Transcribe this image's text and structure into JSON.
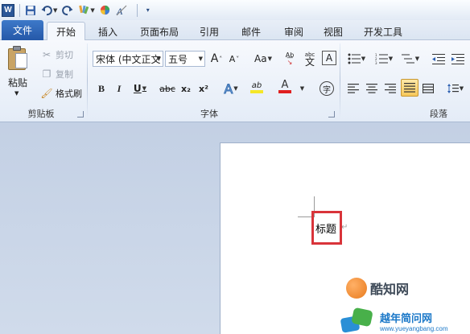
{
  "qat": {
    "app_icon_letter": "W",
    "buttons": [
      "save-icon",
      "undo-icon",
      "redo-icon",
      "highlighter-icon",
      "color-wheel-icon",
      "clear-format-icon"
    ]
  },
  "tabs": {
    "file": "文件",
    "items": [
      "开始",
      "插入",
      "页面布局",
      "引用",
      "邮件",
      "审阅",
      "视图",
      "开发工具"
    ],
    "active": "开始"
  },
  "clipboard": {
    "paste": "粘贴",
    "cut": "剪切",
    "copy": "复制",
    "format_painter": "格式刷",
    "group": "剪贴板"
  },
  "font": {
    "family": "宋体 (中文正文",
    "size": "五号",
    "grow": "A",
    "shrink": "A",
    "change_case": "Aa",
    "bold": "B",
    "italic": "I",
    "underline": "U",
    "strike": "abc",
    "subscript": "x₂",
    "superscript": "x²",
    "text_effect": "A",
    "highlight": "ab",
    "font_color": "A",
    "enclose": "字",
    "phonetic": "abc",
    "phonetic_ch": "文",
    "char_border": "A",
    "group": "字体"
  },
  "paragraph": {
    "group": "段落"
  },
  "document": {
    "text": "标题",
    "pilcrow": "↵"
  },
  "watermark": {
    "site1": "酷知网",
    "site2": "越年简问网",
    "site2_url": "www.yueyangbang.com"
  },
  "colors": {
    "accent": "#2b5797",
    "file_tab": "#2a5fae",
    "highlight_box": "#d9343a",
    "font_color_bar": "#e02020",
    "highlight_bar": "#f5e728"
  }
}
